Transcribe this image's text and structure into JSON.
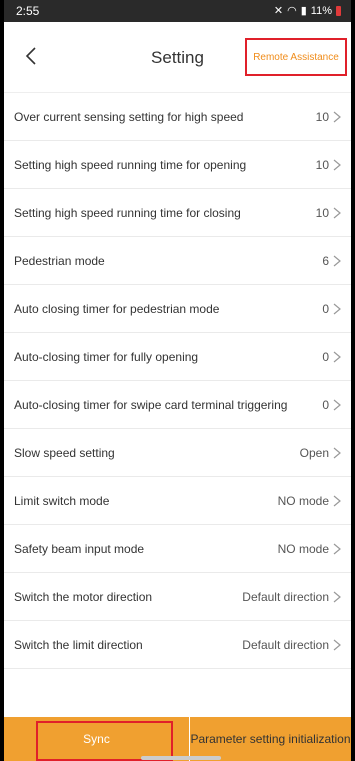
{
  "status": {
    "time": "2:55",
    "battery": "11%"
  },
  "header": {
    "title": "Setting",
    "remote_label": "Remote Assistance"
  },
  "settings": [
    {
      "label": "Over current sensing setting for high speed",
      "value": "10"
    },
    {
      "label": "Setting high speed running time for opening",
      "value": "10"
    },
    {
      "label": "Setting high speed running time for closing",
      "value": "10"
    },
    {
      "label": "Pedestrian mode",
      "value": "6"
    },
    {
      "label": "Auto closing timer for pedestrian mode",
      "value": "0"
    },
    {
      "label": "Auto-closing timer for fully opening",
      "value": "0"
    },
    {
      "label": "Auto-closing timer for swipe card terminal triggering",
      "value": "0"
    },
    {
      "label": "Slow speed setting",
      "value": "Open"
    },
    {
      "label": "Limit switch mode",
      "value": "NO mode"
    },
    {
      "label": "Safety beam input mode",
      "value": "NO mode"
    },
    {
      "label": "Switch the motor direction",
      "value": "Default direction"
    },
    {
      "label": "Switch the limit direction",
      "value": "Default direction"
    }
  ],
  "footer": {
    "sync_label": "Sync",
    "init_label": "Parameter setting initialization"
  },
  "colors": {
    "accent": "#f0a030",
    "highlight": "#e0202a"
  }
}
